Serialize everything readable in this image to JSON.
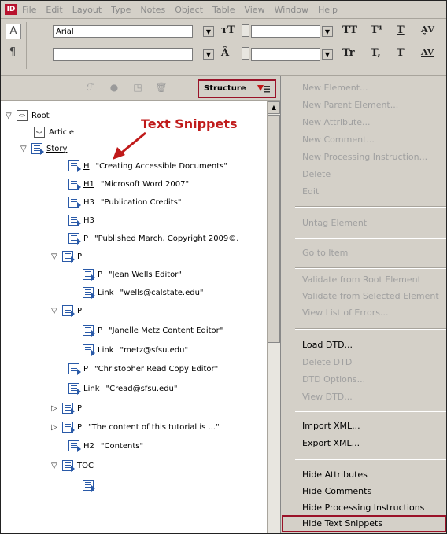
{
  "app": {
    "icon_label": "ID"
  },
  "menubar": [
    "File",
    "Edit",
    "Layout",
    "Type",
    "Notes",
    "Object",
    "Table",
    "View",
    "Window",
    "Help"
  ],
  "control_panel": {
    "font_family": "Arial",
    "font_style": ""
  },
  "structure_panel": {
    "tab_label": "Structure"
  },
  "annotation": {
    "label": "Text Snippets",
    "color": "#c01a1a"
  },
  "tree": [
    {
      "tag": "Root",
      "text": "",
      "icon": "bracket"
    },
    {
      "tag": "Article",
      "text": "",
      "icon": "bracket"
    },
    {
      "tag": "Story",
      "text": "",
      "icon": "story"
    },
    {
      "tag": "H",
      "text": "\"Creating Accessible Documents\"",
      "icon": "para"
    },
    {
      "tag": "H1",
      "text": "\"Microsoft Word 2007\"",
      "icon": "para"
    },
    {
      "tag": "H3",
      "text": "\"Publication Credits\"",
      "icon": "para"
    },
    {
      "tag": "H3",
      "text": "",
      "icon": "para"
    },
    {
      "tag": "P",
      "text": "\"Published March, Copyright 2009©.",
      "icon": "para"
    },
    {
      "tag": "P",
      "text": "",
      "icon": "para"
    },
    {
      "tag": "P",
      "text": "\"Jean Wells Editor\"",
      "icon": "para"
    },
    {
      "tag": "Link",
      "text": "\"wells@calstate.edu\"",
      "icon": "para"
    },
    {
      "tag": "P",
      "text": "",
      "icon": "para"
    },
    {
      "tag": "P",
      "text": "\"Janelle Metz Content Editor\"",
      "icon": "para"
    },
    {
      "tag": "Link",
      "text": "\"metz@sfsu.edu\"",
      "icon": "para"
    },
    {
      "tag": "P",
      "text": "\"Christopher Read Copy Editor\"",
      "icon": "para"
    },
    {
      "tag": "Link",
      "text": "\"Cread@sfsu.edu\"",
      "icon": "para"
    },
    {
      "tag": "P",
      "text": "",
      "icon": "para"
    },
    {
      "tag": "P",
      "text": "\"The content of this tutorial is ...\"",
      "icon": "para"
    },
    {
      "tag": "H2",
      "text": "\"Contents\"",
      "icon": "para"
    },
    {
      "tag": "TOC",
      "text": "",
      "icon": "para"
    }
  ],
  "context_menu": [
    {
      "label": "New Element...",
      "enabled": false
    },
    {
      "label": "New Parent Element...",
      "enabled": false
    },
    {
      "label": "New Attribute...",
      "enabled": false
    },
    {
      "label": "New Comment...",
      "enabled": false
    },
    {
      "label": "New Processing Instruction...",
      "enabled": false
    },
    {
      "label": "Delete",
      "enabled": false
    },
    {
      "label": "Edit",
      "enabled": false
    },
    {
      "label": "Untag Element",
      "enabled": false
    },
    {
      "label": "Go to Item",
      "enabled": false
    },
    {
      "label": "Validate from Root Element",
      "enabled": false
    },
    {
      "label": "Validate from Selected Element",
      "enabled": false
    },
    {
      "label": "View List of Errors...",
      "enabled": false
    },
    {
      "label": "Load DTD...",
      "enabled": true
    },
    {
      "label": "Delete DTD",
      "enabled": false
    },
    {
      "label": "DTD Options...",
      "enabled": false
    },
    {
      "label": "View DTD...",
      "enabled": false
    },
    {
      "label": "Import XML...",
      "enabled": true
    },
    {
      "label": "Export XML...",
      "enabled": true
    },
    {
      "label": "Hide Attributes",
      "enabled": true
    },
    {
      "label": "Hide Comments",
      "enabled": true
    },
    {
      "label": "Hide Processing Instructions",
      "enabled": true
    },
    {
      "label": "Hide Text Snippets",
      "enabled": true
    }
  ]
}
